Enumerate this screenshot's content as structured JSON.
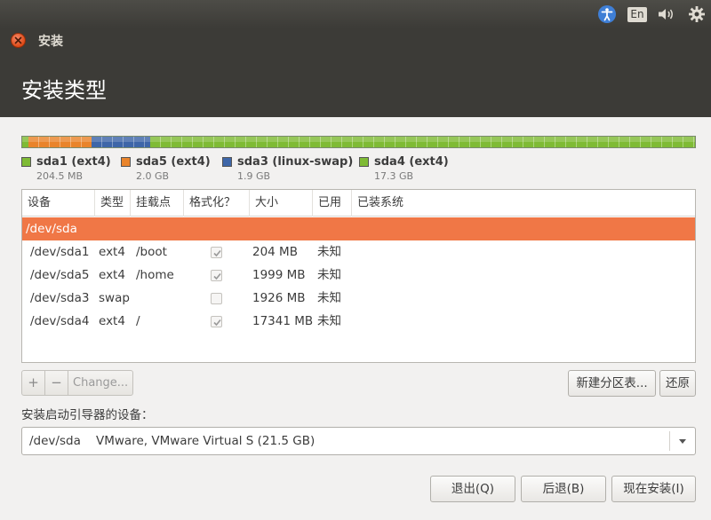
{
  "panel": {
    "language_indicator": "En",
    "icons": [
      "accessibility-icon",
      "keyboard-layout-icon",
      "volume-icon",
      "gear-icon"
    ]
  },
  "window": {
    "title": "安装",
    "heading": "安装类型"
  },
  "colors": {
    "accent": "#f07746",
    "ext4": "#7fbb35",
    "linux_swap": "#3e66a8",
    "sda5": "#e9842b"
  },
  "partition_bar": {
    "segments": [
      {
        "name": "sda1",
        "fraction": 0.0095
      },
      {
        "name": "sda5",
        "fraction": 0.093
      },
      {
        "name": "sda3",
        "fraction": 0.088
      },
      {
        "name": "sda4",
        "fraction": 0.8095
      }
    ]
  },
  "legend": [
    {
      "name": "sda1 (ext4)",
      "size": "204.5 MB",
      "color": "#7fbb35"
    },
    {
      "name": "sda5 (ext4)",
      "size": "2.0 GB",
      "color": "#e9842b"
    },
    {
      "name": "sda3 (linux-swap)",
      "size": "1.9 GB",
      "color": "#3e66a8"
    },
    {
      "name": "sda4 (ext4)",
      "size": "17.3 GB",
      "color": "#7fbb35"
    }
  ],
  "table": {
    "columns": [
      "设备",
      "类型",
      "挂载点",
      "格式化？",
      "大小",
      "已用",
      "已装系统"
    ],
    "device_row": "/dev/sda",
    "rows": [
      {
        "device": "/dev/sda1",
        "type": "ext4",
        "mount": "/boot",
        "format": true,
        "size": "204 MB",
        "used": "未知",
        "system": ""
      },
      {
        "device": "/dev/sda5",
        "type": "ext4",
        "mount": "/home",
        "format": true,
        "size": "1999 MB",
        "used": "未知",
        "system": ""
      },
      {
        "device": "/dev/sda3",
        "type": "swap",
        "mount": "",
        "format": false,
        "size": "1926 MB",
        "used": "未知",
        "system": ""
      },
      {
        "device": "/dev/sda4",
        "type": "ext4",
        "mount": "/",
        "format": true,
        "size": "17341 MB",
        "used": "未知",
        "system": ""
      }
    ]
  },
  "toolbar": {
    "add_label": "+",
    "remove_label": "−",
    "change_label": "Change..."
  },
  "buttons": {
    "new_table": "新建分区表...",
    "revert": "还原",
    "quit": "退出(Q)",
    "back": "后退(B)",
    "install_now": "现在安装(I)"
  },
  "bootloader": {
    "label": "安装启动引导器的设备：",
    "selected": "/dev/sda    VMware, VMware Virtual S (21.5 GB)"
  }
}
